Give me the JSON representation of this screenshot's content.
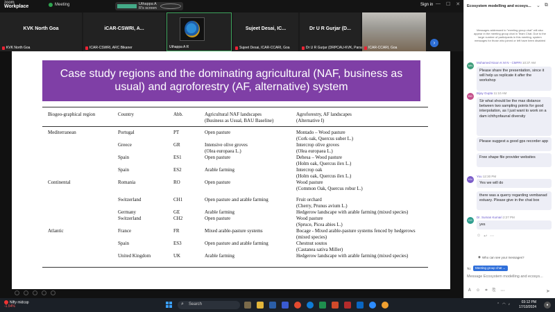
{
  "zoom": {
    "logo_top": "zoom",
    "logo_bottom": "Workplace",
    "meeting_label": "Meeting",
    "screen_label": "Uthappa A R's screen",
    "signin": "Sign in"
  },
  "participants": [
    {
      "display": "KVK North Goa",
      "caption": "KVK North Goa"
    },
    {
      "display": "iCAR-CSWRI, A...",
      "caption": "ICAR-CSWRI, ARC Bikaner"
    },
    {
      "display": "",
      "caption": "Uthappa A R"
    },
    {
      "display": "Sujeet Desai, IC...",
      "caption": "Sujeet Desai, ICAR-CCARI, Goa"
    },
    {
      "display": "Dr U R Gurjar (D...",
      "caption": "Dr U R Gurjar (DRPCAU-KVK, Parsa..."
    },
    {
      "display": "",
      "caption": "ICAR-CCARI, Goa"
    }
  ],
  "slide": {
    "title": "Case study regions and the dominating agricultural (NAF, business as usual) and agroforestry (AF, alternative) system",
    "headers": {
      "region": "Biogeo-graphical region",
      "country": "Country",
      "abb": "Abb.",
      "naf1": "Agricultural NAF landscapes",
      "naf2": "(Business as Usual, BAU Baseline)",
      "af1": "Agroforestry, AF landscapes",
      "af2": "(Alternative I)"
    },
    "cells": [
      {
        "t": "Mediterranean"
      },
      {
        "t": "Portugal"
      },
      {
        "t": "PT"
      },
      {
        "t": "Open pasture"
      },
      {
        "t": "Montado – Wood pasture"
      },
      {
        "t": "(Cork oak, Quercus suber L.)"
      },
      {
        "t": "Greece"
      },
      {
        "t": "GR"
      },
      {
        "t": "Intensive olive groves"
      },
      {
        "t": "Intercrop olive groves"
      },
      {
        "t": "(Olea europaea L.)"
      },
      {
        "t": "(Olea europaea L.)"
      },
      {
        "t": "Spain"
      },
      {
        "t": "ES1"
      },
      {
        "t": "Open pasture"
      },
      {
        "t": "Dehesa – Wood pasture"
      },
      {
        "t": "(Holm oak, Quercus ilex L.)"
      },
      {
        "t": "Spain"
      },
      {
        "t": "ES2"
      },
      {
        "t": "Arable farming"
      },
      {
        "t": "Intercrop oak"
      },
      {
        "t": "(Holm oak, Quercus ilex L.)"
      },
      {
        "t": "Continental"
      },
      {
        "t": "Romania"
      },
      {
        "t": "RO"
      },
      {
        "t": "Open pasture"
      },
      {
        "t": "Wood pasture"
      },
      {
        "t": "(Common Oak, Quercus robur L.)"
      },
      {
        "t": "Switzerland"
      },
      {
        "t": "CH1"
      },
      {
        "t": "Open pasture and arable farming"
      },
      {
        "t": "Fruit orchard"
      },
      {
        "t": "(Cherry, Prunus avium L.)"
      },
      {
        "t": "Germany"
      },
      {
        "t": "GE"
      },
      {
        "t": "Arable farming"
      },
      {
        "t": "Hedgerow landscape with arable farming (mixed species)"
      },
      {
        "t": "Switzerland"
      },
      {
        "t": "CH2"
      },
      {
        "t": "Open pasture"
      },
      {
        "t": "Wood pasture"
      },
      {
        "t": "(Spruce, Picea abies L.)"
      },
      {
        "t": "Atlantic"
      },
      {
        "t": "France"
      },
      {
        "t": "FR"
      },
      {
        "t": "Mixed arable-pasture systems"
      },
      {
        "t": "Bocage - Mixed arable-pasture systems fenced by hedgerows"
      },
      {
        "t": "(mixed species)"
      },
      {
        "t": "Spain"
      },
      {
        "t": "ES3"
      },
      {
        "t": "Open pasture and arable farming"
      },
      {
        "t": "Chestnut soutos"
      },
      {
        "t": "(Castanea sativa Miller)"
      },
      {
        "t": "United Kingdom"
      },
      {
        "t": "UK"
      },
      {
        "t": "Arable farming"
      },
      {
        "t": "Hedgerow landscape with arable farming (mixed species)"
      }
    ]
  },
  "chat": {
    "title": "Ecosystem modelling and ecosys...",
    "notice": "Messages addressed to \"meeting group chat\" will also appear in the meeting group chat in Team Chat. Due to the large number of participants in this meeting, system messages for those who joined or left have been disabled",
    "messages": [
      {
        "initials": "MN",
        "color": "#3d9c7a",
        "sender": "Mohamed Nixon K M N - CMFRI",
        "time": "10:37 AM",
        "text": "Please share the presentation, since it will help us replicate it after the workshop"
      },
      {
        "initials": "BG",
        "color": "#c44e8a",
        "sender": "Bijay Gupta",
        "time": "11:10 AM",
        "text": "Sir what should be the max distance between two sampling points for good interpolation, as I just want to work on a dam ichthyofaunal diversity"
      },
      {
        "initials": "",
        "color": "",
        "sender": "",
        "time": "",
        "text": "Please suggest a good gps recorder app"
      },
      {
        "initials": "",
        "color": "",
        "sender": "",
        "time": "",
        "text": "Free shape file provider websites"
      },
      {
        "initials": "KN",
        "color": "#7b5cc9",
        "sender": "You",
        "time": "12:30 PM",
        "text": "Yes we will do"
      },
      {
        "initials": "",
        "color": "",
        "sender": "",
        "time": "",
        "text": "there was a querry regarding vembanad estuary. Please give in the chat box"
      },
      {
        "initials": "DS",
        "color": "#2f9e8f",
        "sender": "Dr. Suman Kumari",
        "time": "2:27 PM",
        "text": "yes"
      }
    ],
    "who_can_see": "Who can see your messages?",
    "to_label": "To:",
    "to_chip": "Meeting group chat ⌄",
    "input_placeholder": "Message Ecosystem modelling and ecosys..."
  },
  "taskbar": {
    "ticker_name": "Nifty midcap",
    "ticker_change": "-1.54%",
    "search": "Search",
    "time": "03:12 PM",
    "date": "17/10/2024"
  }
}
